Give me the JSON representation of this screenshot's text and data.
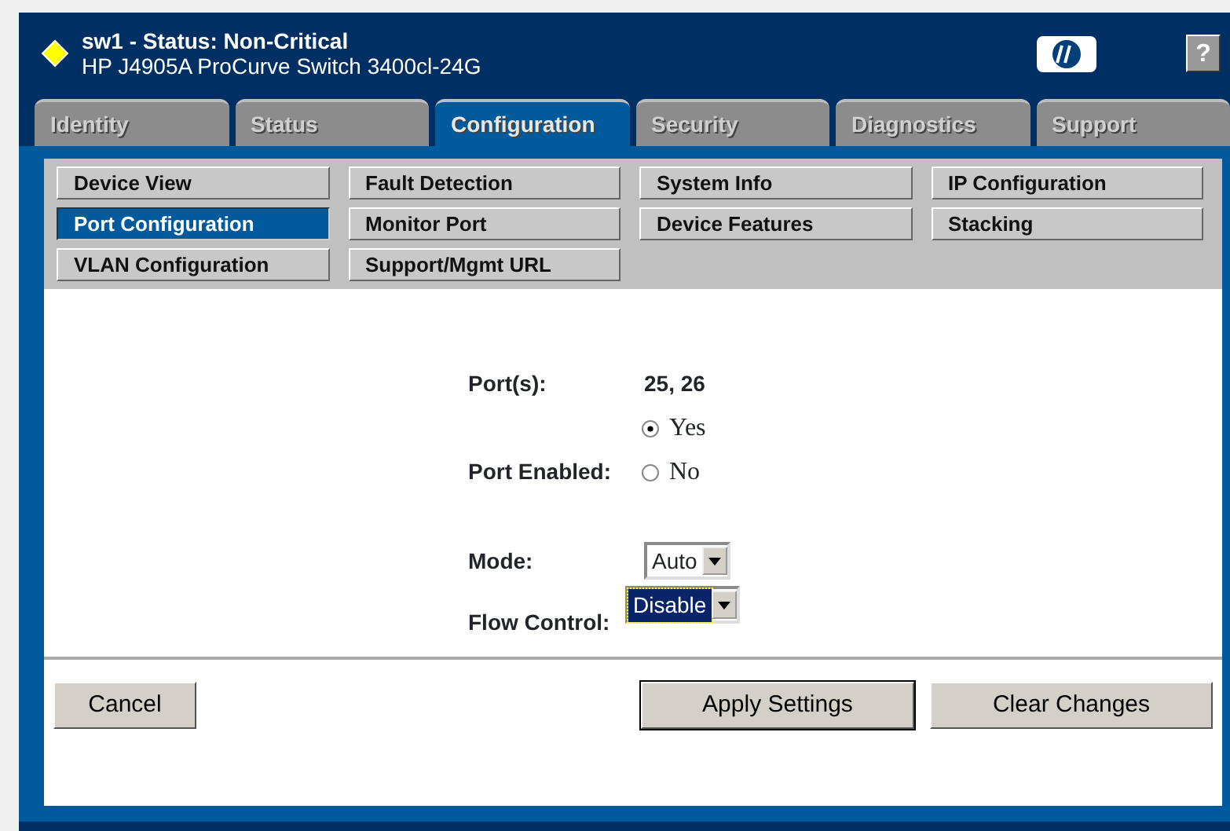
{
  "header": {
    "title": "sw1 - Status:  Non-Critical",
    "subtitle": "HP J4905A ProCurve Switch 3400cl-24G",
    "help": "?"
  },
  "tabs": [
    {
      "label": "Identity",
      "selected": false
    },
    {
      "label": "Status",
      "selected": false
    },
    {
      "label": "Configuration",
      "selected": true
    },
    {
      "label": "Security",
      "selected": false
    },
    {
      "label": "Diagnostics",
      "selected": false
    },
    {
      "label": "Support",
      "selected": false
    }
  ],
  "menu": [
    {
      "label": "Device View",
      "selected": false
    },
    {
      "label": "Fault Detection",
      "selected": false
    },
    {
      "label": "System Info",
      "selected": false
    },
    {
      "label": "IP Configuration",
      "selected": false
    },
    {
      "label": "Port Configuration",
      "selected": true
    },
    {
      "label": "Monitor Port",
      "selected": false
    },
    {
      "label": "Device Features",
      "selected": false
    },
    {
      "label": "Stacking",
      "selected": false
    },
    {
      "label": "VLAN Configuration",
      "selected": false
    },
    {
      "label": "Support/Mgmt URL",
      "selected": false
    }
  ],
  "form": {
    "ports_label": "Port(s):",
    "ports_value": "25, 26",
    "enabled_label": "Port Enabled:",
    "enabled_options": [
      {
        "label": "Yes",
        "selected": true
      },
      {
        "label": "No",
        "selected": false
      }
    ],
    "mode_label": "Mode:",
    "mode_value": "Auto",
    "flow_label": "Flow Control:",
    "flow_value": "Disable"
  },
  "buttons": [
    {
      "label": "Cancel",
      "kind": "left"
    },
    {
      "label": "Apply Settings",
      "kind": "default"
    },
    {
      "label": "Clear Changes",
      "kind": "right"
    }
  ]
}
